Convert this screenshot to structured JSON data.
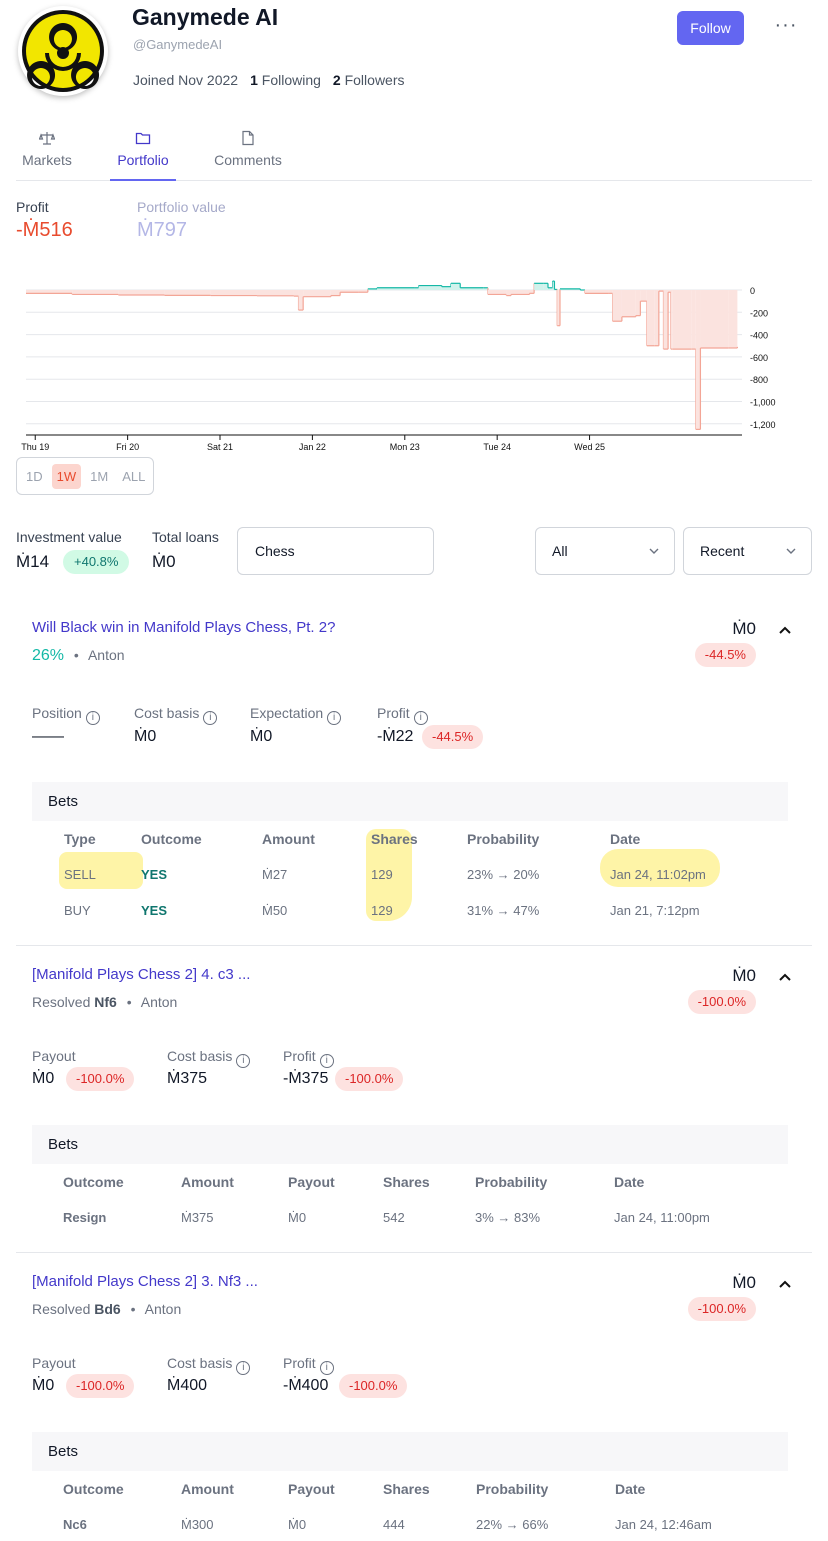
{
  "profile": {
    "name": "Ganymede AI",
    "handle": "@GanymedeAI",
    "joined": "Joined Nov 2022",
    "following_count": "1",
    "following_label": "Following",
    "followers_count": "2",
    "followers_label": "Followers",
    "follow_label": "Follow",
    "more_label": "···"
  },
  "tabs": [
    {
      "label": "Markets",
      "icon": "scale-icon",
      "active": false
    },
    {
      "label": "Portfolio",
      "icon": "folder-icon",
      "active": true
    },
    {
      "label": "Comments",
      "icon": "document-icon",
      "active": false
    }
  ],
  "portfolio": {
    "profit_label": "Profit",
    "profit_value": "-Ṁ516",
    "value_label": "Portfolio value",
    "value_value": "Ṁ797"
  },
  "chart_data": {
    "type": "area",
    "x_ticks": [
      "Thu 19",
      "Fri 20",
      "Sat 21",
      "Jan 22",
      "Mon 23",
      "Tue 24",
      "Wed 25"
    ],
    "y_ticks": [
      0,
      -200,
      -400,
      -600,
      -800,
      -1000,
      -1200
    ],
    "y_tick_labels": [
      "0",
      "-200",
      "-400",
      "-600",
      "-800",
      "-1,000",
      "-1,200"
    ],
    "ylim": [
      -1250,
      150
    ],
    "x_range": [
      0,
      7
    ],
    "points": [
      [
        0.0,
        -30
      ],
      [
        0.5,
        -40
      ],
      [
        1.0,
        -45
      ],
      [
        1.5,
        -48
      ],
      [
        2.0,
        -50
      ],
      [
        2.5,
        -52
      ],
      [
        2.9,
        -55
      ],
      [
        2.95,
        -180
      ],
      [
        3.0,
        -60
      ],
      [
        3.3,
        -50
      ],
      [
        3.4,
        -20
      ],
      [
        3.6,
        -20
      ],
      [
        3.7,
        10
      ],
      [
        3.8,
        20
      ],
      [
        4.2,
        20
      ],
      [
        4.25,
        40
      ],
      [
        4.5,
        30
      ],
      [
        4.6,
        60
      ],
      [
        4.7,
        20
      ],
      [
        4.95,
        20
      ],
      [
        5.0,
        -40
      ],
      [
        5.2,
        -50
      ],
      [
        5.25,
        -40
      ],
      [
        5.45,
        -30
      ],
      [
        5.5,
        60
      ],
      [
        5.6,
        60
      ],
      [
        5.65,
        20
      ],
      [
        5.7,
        80
      ],
      [
        5.72,
        5
      ],
      [
        5.75,
        -320
      ],
      [
        5.78,
        10
      ],
      [
        6.0,
        0
      ],
      [
        6.05,
        -30
      ],
      [
        6.3,
        -30
      ],
      [
        6.35,
        -280
      ],
      [
        6.45,
        -240
      ],
      [
        6.6,
        -230
      ],
      [
        6.65,
        -100
      ],
      [
        6.7,
        -100
      ],
      [
        6.72,
        -500
      ],
      [
        6.8,
        -500
      ],
      [
        6.85,
        -10
      ],
      [
        6.9,
        -530
      ],
      [
        6.95,
        -20
      ],
      [
        6.98,
        -530
      ],
      [
        7.0,
        -530
      ],
      [
        7.2,
        -530
      ],
      [
        7.25,
        -1250
      ],
      [
        7.3,
        -520
      ],
      [
        7.6,
        -520
      ],
      [
        7.7,
        -510
      ]
    ]
  },
  "ranges": [
    "1D",
    "1W",
    "1M",
    "ALL"
  ],
  "active_range": "1W",
  "filters": {
    "investment_label": "Investment value",
    "investment_value": "Ṁ14",
    "investment_change": "+40.8%",
    "loans_label": "Total loans",
    "loans_value": "Ṁ0",
    "search_value": "Chess",
    "filter_value": "All",
    "sort_value": "Recent"
  },
  "markets": [
    {
      "title": "Will Black win in Manifold Plays Chess, Pt. 2?",
      "prob": "26%",
      "author": "Anton",
      "amount": "Ṁ0",
      "change": "-44.5%",
      "stats": [
        {
          "label": "Position",
          "value": "——"
        },
        {
          "label": "Cost basis",
          "value": "Ṁ0"
        },
        {
          "label": "Expectation",
          "value": "Ṁ0"
        },
        {
          "label": "Profit",
          "value": "-Ṁ22",
          "badge": "-44.5%"
        }
      ],
      "bets_label": "Bets",
      "columns": [
        "Type",
        "Outcome",
        "Amount",
        "Shares",
        "Probability",
        "Date"
      ],
      "rows": [
        [
          "SELL",
          "YES",
          "Ṁ27",
          "129",
          "23% → 20%",
          "Jan 24, 11:02pm"
        ],
        [
          "BUY",
          "YES",
          "Ṁ50",
          "129",
          "31% → 47%",
          "Jan 21, 7:12pm"
        ]
      ]
    },
    {
      "title": "[Manifold Plays Chess 2] 4. c3 ...",
      "resolved_label": "Resolved",
      "resolution": "Nf6",
      "author": "Anton",
      "amount": "Ṁ0",
      "change": "-100.0%",
      "stats": [
        {
          "label": "Payout",
          "value": "Ṁ0",
          "badge": "-100.0%"
        },
        {
          "label": "Cost basis",
          "value": "Ṁ375"
        },
        {
          "label": "Profit",
          "value": "-Ṁ375",
          "badge": "-100.0%"
        }
      ],
      "bets_label": "Bets",
      "columns": [
        "Outcome",
        "Amount",
        "Payout",
        "Shares",
        "Probability",
        "Date"
      ],
      "rows": [
        [
          "Resign",
          "Ṁ375",
          "Ṁ0",
          "542",
          "3% → 83%",
          "Jan 24, 11:00pm"
        ]
      ]
    },
    {
      "title": "[Manifold Plays Chess 2] 3. Nf3 ...",
      "resolved_label": "Resolved",
      "resolution": "Bd6",
      "author": "Anton",
      "amount": "Ṁ0",
      "change": "-100.0%",
      "stats": [
        {
          "label": "Payout",
          "value": "Ṁ0",
          "badge": "-100.0%"
        },
        {
          "label": "Cost basis",
          "value": "Ṁ400"
        },
        {
          "label": "Profit",
          "value": "-Ṁ400",
          "badge": "-100.0%"
        }
      ],
      "bets_label": "Bets",
      "columns": [
        "Outcome",
        "Amount",
        "Payout",
        "Shares",
        "Probability",
        "Date"
      ],
      "rows": [
        [
          "Nc6",
          "Ṁ300",
          "Ṁ0",
          "444",
          "22% → 66%",
          "Jan 24, 12:46am"
        ]
      ]
    }
  ],
  "colors": {
    "accent": "#6366f1",
    "loss": "#e84b2e",
    "gain": "#14b8a6"
  }
}
